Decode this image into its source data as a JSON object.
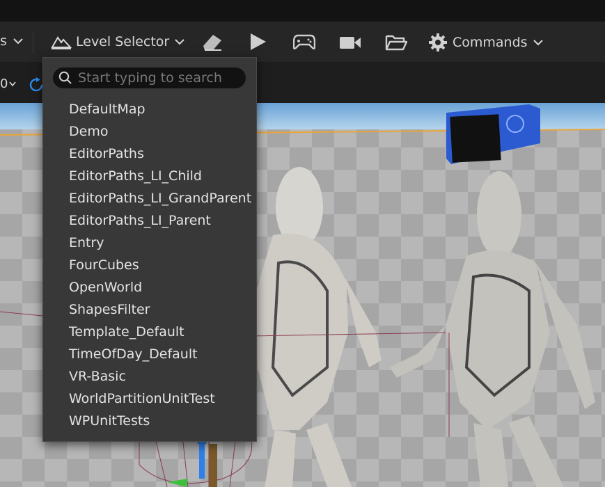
{
  "toolbar": {
    "left_fragment": "s",
    "level_selector_label": "Level Selector",
    "commands_label": "Commands"
  },
  "subbar": {
    "fragment": "0"
  },
  "level_dropdown": {
    "search_placeholder": "Start typing to search",
    "levels": [
      "DefaultMap",
      "Demo",
      "EditorPaths",
      "EditorPaths_LI_Child",
      "EditorPaths_LI_GrandParent",
      "EditorPaths_LI_Parent",
      "Entry",
      "FourCubes",
      "OpenWorld",
      "ShapesFilter",
      "Template_Default",
      "TimeOfDay_Default",
      "VR-Basic",
      "WorldPartitionUnitTest",
      "WPUnitTests"
    ]
  }
}
